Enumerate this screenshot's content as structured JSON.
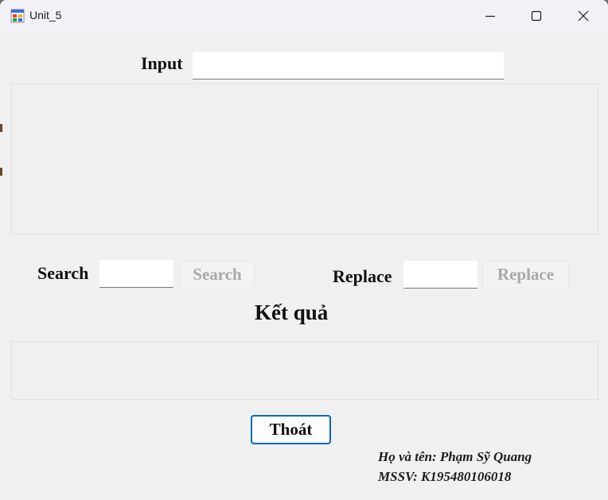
{
  "window": {
    "title": "Unit_5",
    "controls": {
      "minimize": "minimize",
      "maximize": "maximize",
      "close": "close"
    }
  },
  "form": {
    "input_label": "Input",
    "input_value": "",
    "search_label": "Search",
    "search_value": "",
    "search_button": "Search",
    "replace_label": "Replace",
    "replace_value": "",
    "replace_button": "Replace",
    "result_label": "Kết quả",
    "exit_button": "Thoát"
  },
  "footer": {
    "name_line": "Họ và tên: Phạm Sỹ Quang",
    "id_line": "MSSV: K195480106018"
  },
  "colors": {
    "window_bg": "#f0f0f0",
    "titlebar_bg": "#f2f1f6",
    "accent_border": "#0067c0",
    "disabled_text": "#a8a8a8"
  }
}
